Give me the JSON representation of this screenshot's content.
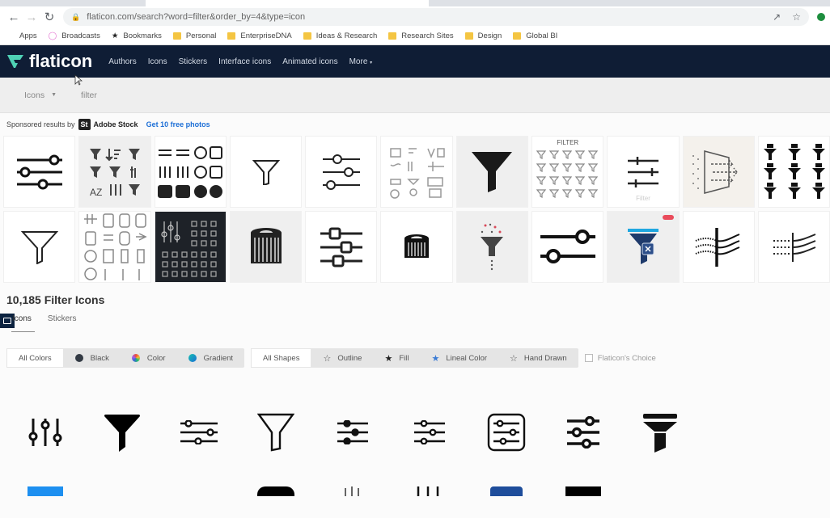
{
  "browser": {
    "url": "flaticon.com/search?word=filter&order_by=4&type=icon",
    "bookmarks": [
      {
        "label": "Apps",
        "icon": "apps-grid-icon"
      },
      {
        "label": "Broadcasts",
        "icon": "broadcast-icon"
      },
      {
        "label": "Bookmarks",
        "icon": "star-icon"
      },
      {
        "label": "Personal",
        "icon": "folder-icon"
      },
      {
        "label": "EnterpriseDNA",
        "icon": "folder-icon"
      },
      {
        "label": "Ideas & Research",
        "icon": "folder-icon"
      },
      {
        "label": "Research Sites",
        "icon": "folder-icon"
      },
      {
        "label": "Design",
        "icon": "folder-icon"
      },
      {
        "label": "Global BI",
        "icon": "folder-icon"
      }
    ]
  },
  "site": {
    "brand": "flaticon",
    "brand_color": "#4fd1b5",
    "nav_bg": "#0f1d35",
    "nav": [
      "Authors",
      "Icons",
      "Stickers",
      "Interface icons",
      "Animated icons",
      "More"
    ]
  },
  "search": {
    "type": "Icons",
    "query": "filter"
  },
  "sponsored": {
    "prefix": "Sponsored results by",
    "logo": "St",
    "provider": "Adobe Stock",
    "cta": "Get 10 free photos",
    "tile_captions": {
      "filter_set_title": "FILTER",
      "sliders_caption": "Filter"
    }
  },
  "results": {
    "title": "10,185 Filter Icons",
    "tabs": [
      "Icons",
      "Stickers"
    ],
    "color_filters": [
      {
        "label": "All Colors",
        "active": true
      },
      {
        "label": "Black",
        "swatch": "#333a44"
      },
      {
        "label": "Color",
        "swatch": "conic"
      },
      {
        "label": "Gradient",
        "swatch": "#1a8fd6"
      }
    ],
    "shape_filters": [
      {
        "label": "All Shapes",
        "active": true
      },
      {
        "label": "Outline",
        "icon": "star-outline-icon"
      },
      {
        "label": "Fill",
        "icon": "star-fill-icon"
      },
      {
        "label": "Lineal Color",
        "icon": "star-color-icon"
      },
      {
        "label": "Hand Drawn",
        "icon": "star-hand-icon"
      }
    ],
    "flaticon_choice": "Flaticon's Choice",
    "flaticon_choice_checked": false
  }
}
